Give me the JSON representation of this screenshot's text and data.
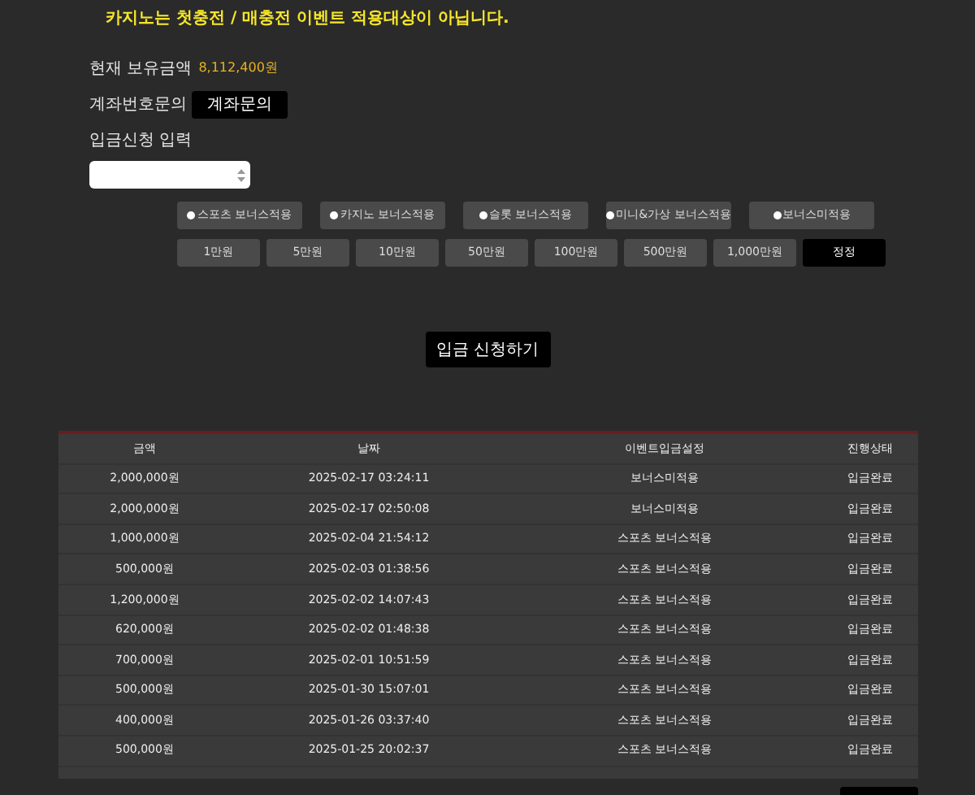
{
  "notice": "카지노는 첫충전 / 매충전 이벤트 적용대상이 아닙니다.",
  "balance": {
    "label": "현재 보유금액",
    "value": "8,112,400원"
  },
  "account_inquiry": {
    "label": "계좌번호문의",
    "button": "계좌문의"
  },
  "deposit_input": {
    "label": "입금신청 입력"
  },
  "bonus_options": [
    {
      "label": "스포츠 보너스적용",
      "selected": false
    },
    {
      "label": "카지노 보너스적용",
      "selected": false
    },
    {
      "label": "슬롯 보너스적용",
      "selected": false
    },
    {
      "label": "미니&가상 보너스적용",
      "selected": false
    },
    {
      "label": "보너스미적용",
      "selected": false
    }
  ],
  "amount_buttons": [
    {
      "label": "1만원",
      "kind": "amount"
    },
    {
      "label": "5만원",
      "kind": "amount"
    },
    {
      "label": "10만원",
      "kind": "amount"
    },
    {
      "label": "50만원",
      "kind": "amount"
    },
    {
      "label": "100만원",
      "kind": "amount"
    },
    {
      "label": "500만원",
      "kind": "amount"
    },
    {
      "label": "1,000만원",
      "kind": "amount"
    },
    {
      "label": "정정",
      "kind": "reset"
    }
  ],
  "submit_button": "입금 신청하기",
  "table": {
    "columns": [
      "금액",
      "날짜",
      "이벤트입금설정",
      "진행상태"
    ],
    "rows": [
      [
        "2,000,000원",
        "2025-02-17 03:24:11",
        "보너스미적용",
        "입금완료"
      ],
      [
        "2,000,000원",
        "2025-02-17 02:50:08",
        "보너스미적용",
        "입금완료"
      ],
      [
        "1,000,000원",
        "2025-02-04 21:54:12",
        "스포츠 보너스적용",
        "입금완료"
      ],
      [
        "500,000원",
        "2025-02-03 01:38:56",
        "스포츠 보너스적용",
        "입금완료"
      ],
      [
        "1,200,000원",
        "2025-02-02 14:07:43",
        "스포츠 보너스적용",
        "입금완료"
      ],
      [
        "620,000원",
        "2025-02-02 01:48:38",
        "스포츠 보너스적용",
        "입금완료"
      ],
      [
        "700,000원",
        "2025-02-01 10:51:59",
        "스포츠 보너스적용",
        "입금완료"
      ],
      [
        "500,000원",
        "2025-01-30 15:07:01",
        "스포츠 보너스적용",
        "입금완료"
      ],
      [
        "400,000원",
        "2025-01-26 03:37:40",
        "스포츠 보너스적용",
        "입금완료"
      ],
      [
        "500,000원",
        "2025-01-25 20:02:37",
        "스포츠 보너스적용",
        "입금완료"
      ]
    ]
  }
}
